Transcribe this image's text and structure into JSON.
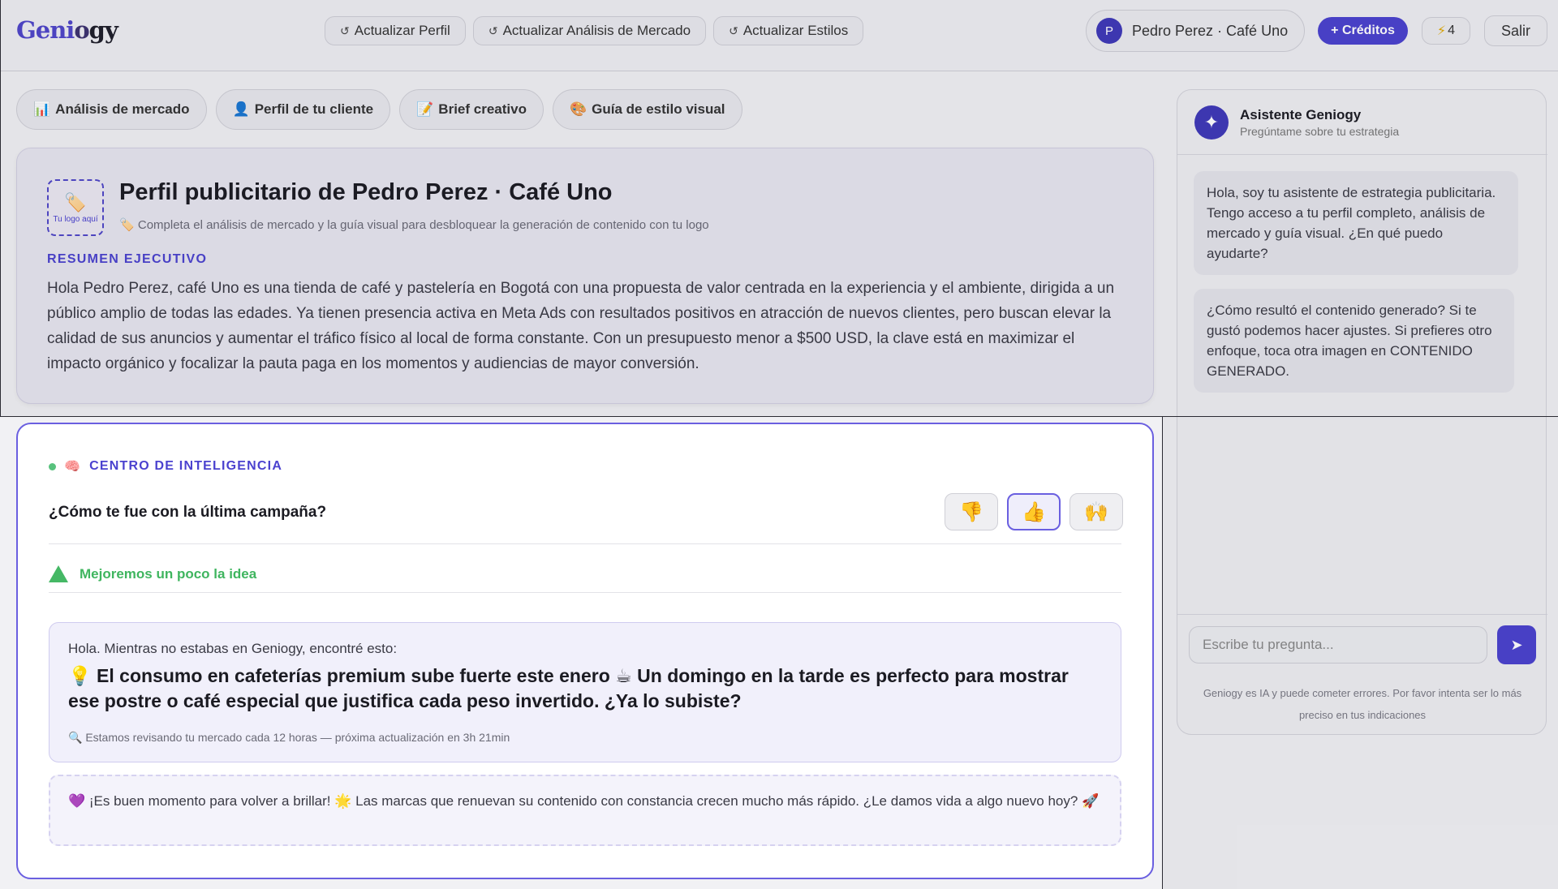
{
  "header": {
    "logo_part1": "Geni",
    "logo_part2": "o",
    "logo_part3": "gy",
    "actions": [
      {
        "icon": "refresh-icon",
        "glyph": "↺",
        "label": "Actualizar Perfil"
      },
      {
        "icon": "refresh-icon",
        "glyph": "↺",
        "label": "Actualizar Análisis de Mercado"
      },
      {
        "icon": "refresh-icon",
        "glyph": "↺",
        "label": "Actualizar Estilos"
      }
    ],
    "user": {
      "initial": "P",
      "name": "Pedro Perez · Café Uno"
    },
    "credits_label": "+ Créditos",
    "bolt_glyph": "⚡",
    "bolt_count": "4",
    "logout_label": "Salir"
  },
  "tabs": [
    {
      "emoji": "📊",
      "label": "Análisis de mercado"
    },
    {
      "emoji": "👤",
      "label": "Perfil de tu cliente"
    },
    {
      "emoji": "📝",
      "label": "Brief creativo"
    },
    {
      "emoji": "🎨",
      "label": "Guía de estilo visual"
    }
  ],
  "profile": {
    "logo_emoji": "🏷️",
    "logo_caption": "Tu logo aquí",
    "title": "Perfil publicitario de Pedro Perez · Café Uno",
    "subtitle_emoji": "🏷️",
    "subtitle": "Completa el análisis de mercado y la guía visual para desbloquear la generación de contenido con tu logo",
    "exec_label": "RESUMEN EJECUTIVO",
    "exec_text": "Hola Pedro Perez, café Uno es una tienda de café y pastelería en Bogotá con una propuesta de valor centrada en la experiencia y el ambiente, dirigida a un público amplio de todas las edades. Ya tienen presencia activa en Meta Ads con resultados positivos en atracción de nuevos clientes, pero buscan elevar la calidad de sus anuncios y aumentar el tráfico físico al local de forma constante. Con un presupuesto menor a $500 USD, la clave está en maximizar el impacto orgánico y focalizar la pauta paga en los momentos y audiencias de mayor conversión."
  },
  "intel": {
    "header_emoji": "🧠",
    "header_label": "CENTRO DE INTELIGENCIA",
    "question": "¿Cómo te fue con la última campaña?",
    "rating_options": [
      {
        "name": "thumbs-down",
        "emoji": "👎"
      },
      {
        "name": "thumbs-up",
        "emoji": "👍"
      },
      {
        "name": "raised-hands",
        "emoji": "🙌"
      }
    ],
    "selected_rating": "thumbs-up",
    "status_label": "Mejoremos un poco la idea",
    "insight_intro": "Hola. Mientras no estabas en Geniogy, encontré esto:",
    "insight_main": "💡 El consumo en cafeterías premium sube fuerte este enero ☕ Un domingo en la tarde es perfecto para mostrar ese postre o café especial que justifica cada peso invertido. ¿Ya lo subiste?",
    "insight_footer": "🔍 Estamos revisando tu mercado cada 12 horas — próxima actualización en 3h 21min",
    "motivation": "💜 ¡Es buen momento para volver a brillar! 🌟 Las marcas que renuevan su contenido con constancia crecen mucho más rápido. ¿Le damos vida a algo nuevo hoy? 🚀"
  },
  "assistant": {
    "icon_glyph": "✦",
    "name": "Asistente Geniogy",
    "subtitle": "Pregúntame sobre tu estrategia",
    "messages": [
      "Hola, soy tu asistente de estrategia publicitaria. Tengo acceso a tu perfil completo, análisis de mercado y guía visual. ¿En qué puedo ayudarte?",
      "¿Cómo resultó el contenido generado? Si te gustó podemos hacer ajustes. Si prefieres otro enfoque, toca otra imagen en CONTENIDO GENERADO."
    ],
    "input_placeholder": "Escribe tu pregunta...",
    "send_glyph": "➤",
    "disclaimer": "Geniogy es IA y puede cometer errores. Por favor intenta ser lo más preciso en tus indicaciones"
  },
  "colors": {
    "accent": "#4b42cf",
    "success": "#45b865",
    "highlight_border": "#6a5fe0"
  }
}
